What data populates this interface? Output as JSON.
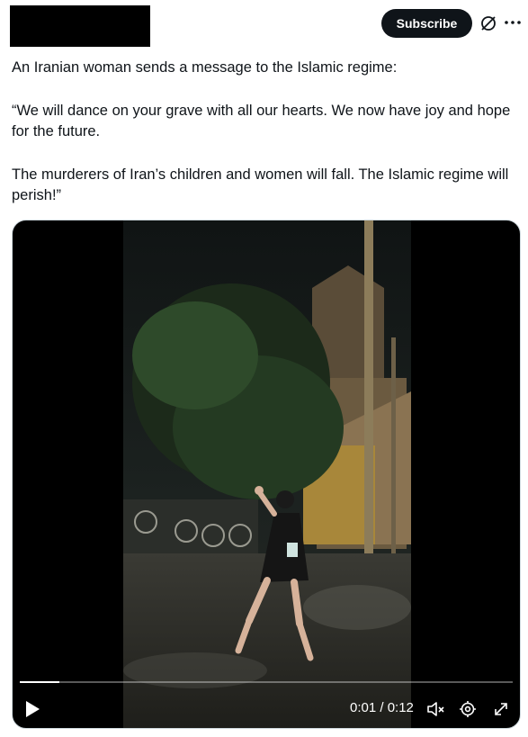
{
  "header": {
    "subscribe_label": "Subscribe",
    "icons": [
      "grok-icon",
      "more-icon"
    ]
  },
  "tweet": {
    "paragraphs": [
      "An Iranian woman sends a message to the Islamic regime:",
      "“We will dance on your grave with all our hearts. We now have joy and hope for the future.",
      "The murderers of Iran’s children and women will fall. The Islamic regime will perish!”"
    ]
  },
  "video": {
    "timecode": "0:01 / 0:12",
    "progress": 0.08,
    "icons": [
      "play-icon",
      "mute-icon",
      "settings-icon",
      "expand-icon"
    ]
  },
  "colors": {
    "text": "#0f1419",
    "button_bg": "#0f1419",
    "media_bg": "#000000"
  }
}
